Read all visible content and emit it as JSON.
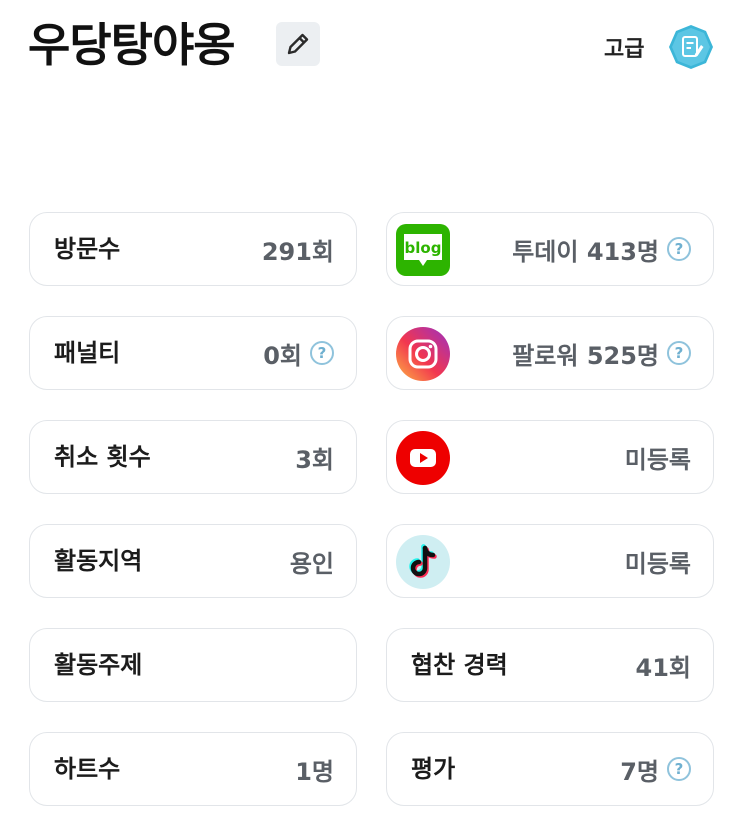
{
  "header": {
    "nickname": "우당탕야옹",
    "grade": "고급"
  },
  "stats": [
    {
      "label": "방문수",
      "value": "291회",
      "help": false
    },
    {
      "label": "패널티",
      "value": "0회",
      "help": true
    },
    {
      "label": "취소 횟수",
      "value": "3회",
      "help": false
    },
    {
      "label": "활동지역",
      "value": "용인",
      "help": false
    },
    {
      "label": "활동주제",
      "value": "",
      "help": false
    },
    {
      "label": "하트수",
      "value": "1명",
      "help": false
    }
  ],
  "channels": [
    {
      "icon": "naver-blog-icon",
      "value": "투데이 413명",
      "help": true
    },
    {
      "icon": "instagram-icon",
      "value": "팔로워 525명",
      "help": true
    },
    {
      "icon": "youtube-icon",
      "value": "미등록",
      "help": false
    },
    {
      "icon": "tiktok-icon",
      "value": "미등록",
      "help": false
    },
    {
      "label": "협찬 경력",
      "value": "41회",
      "help": false
    },
    {
      "label": "평가",
      "value": "7명",
      "help": true
    }
  ],
  "help_glyph": "?",
  "blog_icon_text": "blog",
  "colors": {
    "card_border": "#e2e5e9",
    "help_icon": "#8fc3dc",
    "naver_green": "#2db400",
    "youtube_red": "#ee0000",
    "grade_badge": "#3cb6d8"
  }
}
